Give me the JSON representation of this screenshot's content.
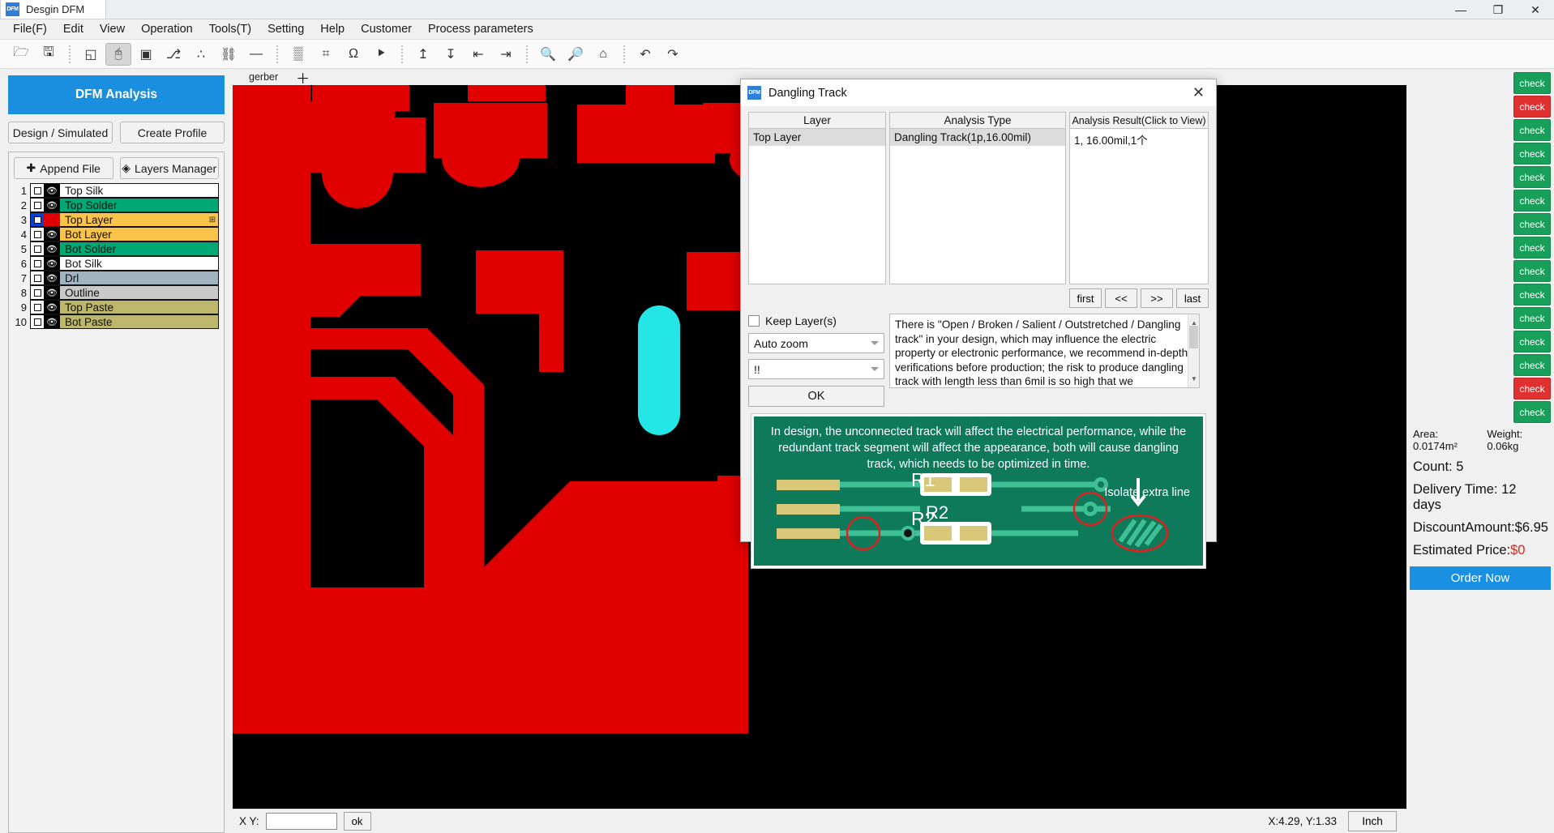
{
  "window": {
    "tab_title": "Desgin DFM",
    "app_icon": "DFM",
    "minimize": "—",
    "maximize": "❐",
    "close": "✕"
  },
  "menubar": {
    "items": [
      "File(F)",
      "Edit",
      "View",
      "Operation",
      "Tools(T)",
      "Setting",
      "Help",
      "Customer",
      "Process parameters"
    ]
  },
  "toolbar": {
    "icons": [
      "open-folder-icon",
      "save-gerber-icon",
      "sep",
      "panel-icon",
      "select-cursor-icon",
      "region-select-icon",
      "net-trace-icon",
      "scatter-points-icon",
      "hierarchy-icon",
      "ruler-icon",
      "sep",
      "panelize-icon",
      "measure-value-icon",
      "impedance-icon",
      "ipc-icon",
      "sep",
      "import-icon",
      "export-icon",
      "align-left-icon",
      "align-right-icon",
      "sep",
      "zoom-in-icon",
      "zoom-out-icon",
      "home-icon",
      "sep",
      "undo-icon",
      "redo-icon"
    ]
  },
  "left_panel": {
    "dfm_analysis_label": "DFM Analysis",
    "design_simulated_label": "Design / Simulated",
    "create_profile_label": "Create Profile",
    "append_file_label": "Append File",
    "layers_manager_label": "Layers Manager",
    "layers": [
      {
        "index": "1",
        "name": "Top Silk",
        "color": "#ffffff",
        "selected": false,
        "swatch": false
      },
      {
        "index": "2",
        "name": "Top Solder",
        "color": "#00a876",
        "selected": false,
        "swatch": false
      },
      {
        "index": "3",
        "name": "Top Layer",
        "color": "#fac44a",
        "selected": true,
        "swatch": true,
        "swatch_color": "#e00000",
        "mark": "⊞"
      },
      {
        "index": "4",
        "name": "Bot Layer",
        "color": "#fac44a",
        "selected": false,
        "swatch": false
      },
      {
        "index": "5",
        "name": "Bot Solder",
        "color": "#00a876",
        "selected": false,
        "swatch": false
      },
      {
        "index": "6",
        "name": "Bot Silk",
        "color": "#ffffff",
        "selected": false,
        "swatch": false
      },
      {
        "index": "7",
        "name": "Drl",
        "color": "#9fb4bf",
        "selected": false,
        "swatch": false
      },
      {
        "index": "8",
        "name": "Outline",
        "color": "#c9c9c9",
        "selected": false,
        "swatch": false
      },
      {
        "index": "9",
        "name": "Top Paste",
        "color": "#bdb76b",
        "selected": false,
        "swatch": false
      },
      {
        "index": "10",
        "name": "Bot Paste",
        "color": "#bdb76b",
        "selected": false,
        "swatch": false
      }
    ]
  },
  "canvas": {
    "tab_label": "gerber",
    "add_tab": "＋"
  },
  "dialog": {
    "title": "Dangling Track",
    "icon": "DFM",
    "close": "✕",
    "columns": {
      "layer": "Layer",
      "analysis_type": "Analysis Type",
      "analysis_result": "Analysis Result(Click to View)"
    },
    "rows": [
      {
        "layer": "Top Layer",
        "analysis_type": "Dangling Track(1p,16.00mil)",
        "analysis_result": "1, 16.00mil,1个"
      }
    ],
    "nav": {
      "first": "first",
      "prev": "<<",
      "next": ">>",
      "last": "last"
    },
    "keep_layers_label": "Keep Layer(s)",
    "keep_layers_checked": false,
    "zoom_select_value": "Auto zoom",
    "severity_select_value": "!!",
    "ok_label": "OK",
    "description": "There is \"Open / Broken / Salient / Outstretched / Dangling track\" in your design, which may influence the electric property or electronic performance, we recommend in-depth verifications before production; the risk to produce dangling track with length less than 6mil is so high that we recommend",
    "illustration_caption": "In design, the unconnected track will affect the electrical performance, while the redundant track segment will affect the appearance, both will cause dangling track, which needs to be optimized in time.",
    "illustration_labels": {
      "r1": "R1",
      "r2": "R2",
      "isolate": "Isolate extra line"
    }
  },
  "right_panel": {
    "check_buttons": [
      {
        "label": "check",
        "color": "#18a05a"
      },
      {
        "label": "check",
        "color": "#e03030"
      },
      {
        "label": "check",
        "color": "#18a05a"
      },
      {
        "label": "check",
        "color": "#18a05a"
      },
      {
        "label": "check",
        "color": "#18a05a"
      },
      {
        "label": "check",
        "color": "#18a05a"
      },
      {
        "label": "check",
        "color": "#18a05a"
      },
      {
        "label": "check",
        "color": "#18a05a"
      },
      {
        "label": "check",
        "color": "#18a05a"
      },
      {
        "label": "check",
        "color": "#18a05a"
      },
      {
        "label": "check",
        "color": "#18a05a"
      },
      {
        "label": "check",
        "color": "#18a05a"
      },
      {
        "label": "check",
        "color": "#18a05a"
      },
      {
        "label": "check",
        "color": "#e03030"
      },
      {
        "label": "check",
        "color": "#18a05a"
      }
    ],
    "area_label": "Area: 0.0174m²",
    "weight_label": "Weight: 0.06kg",
    "count_label": "Count: 5",
    "delivery_label": "Delivery Time: 12 days",
    "discount_label": "DiscountAmount:$6.95",
    "price_prefix": "Estimated Price:",
    "price_value": "$0",
    "order_now_label": "Order Now"
  },
  "statusbar": {
    "xy_label": "X Y:",
    "xy_value": "",
    "ok_label": "ok",
    "coords": "X:4.29, Y:1.33",
    "unit": "Inch"
  }
}
